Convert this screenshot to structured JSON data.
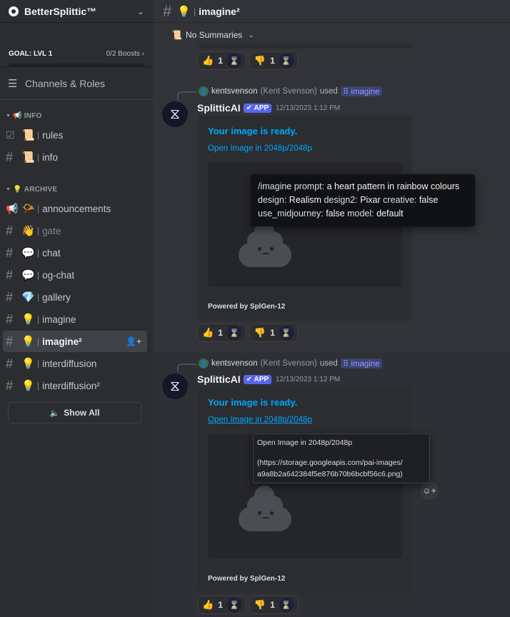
{
  "server": {
    "name": "BetterSplittic™",
    "chevron_icon": "chevron-down-icon"
  },
  "goal": {
    "label": "GOAL: LVL 1",
    "boosts": "0/2 Boosts",
    "progress": 0
  },
  "nav": {
    "channels_roles": "Channels & Roles"
  },
  "categories": [
    {
      "label": "INFO",
      "emoji": "📢"
    },
    {
      "label": "ARCHIVE",
      "emoji": "💡"
    }
  ],
  "channels": [
    {
      "emoji": "📜",
      "name": "rules",
      "icon": "rules-check-icon"
    },
    {
      "emoji": "📜",
      "name": "info",
      "icon": "hash-icon"
    },
    {
      "emoji": "📯",
      "name": "announcements",
      "icon": "megaphone-icon"
    },
    {
      "emoji": "👋",
      "name": "gate",
      "icon": "hash-icon"
    },
    {
      "emoji": "💬",
      "name": "chat",
      "icon": "hash-icon"
    },
    {
      "emoji": "💬",
      "name": "og-chat",
      "icon": "hash-icon"
    },
    {
      "emoji": "💎",
      "name": "gallery",
      "icon": "hash-icon"
    },
    {
      "emoji": "💡",
      "name": "imagine",
      "icon": "hash-icon"
    },
    {
      "emoji": "💡",
      "name": "imagine²",
      "icon": "hash-icon"
    },
    {
      "emoji": "💡",
      "name": "interdiffusion",
      "icon": "hash-icon"
    },
    {
      "emoji": "💡",
      "name": "interdiffusion²",
      "icon": "hash-icon"
    }
  ],
  "show_all": "Show All",
  "topbar": {
    "emoji": "💡",
    "title": "imagine²"
  },
  "summaries": {
    "label": "No Summaries"
  },
  "reactions": {
    "up_emoji": "👍",
    "down_emoji": "👎",
    "up_count": "1",
    "down_count": "1",
    "hourglass": "⌛"
  },
  "messages": [
    {
      "reply_user": "kentsvenson",
      "reply_real": "(Kent Svenson)",
      "reply_used": "used",
      "reply_cmd": "imagine",
      "author": "SplitticAI",
      "badge": "APP",
      "timestamp": "12/13/2023 1:12 PM",
      "embed_title": "Your image is ready.",
      "embed_link": "Open Image in 2048p/2048p",
      "footer": "Powered by SplGen-12"
    },
    {
      "reply_user": "kentsvenson",
      "reply_real": "(Kent Svenson)",
      "reply_used": "used",
      "reply_cmd": "imagine",
      "author": "SplitticAI",
      "badge": "APP",
      "timestamp": "12/13/2023 1:12 PM",
      "embed_title": "Your image is ready.",
      "embed_link": "Open Image in 2048p/2048p",
      "footer": "Powered by SplGen-12"
    }
  ],
  "tooltip_prompt": {
    "k1": "/imagine prompt:",
    "v1": "a heart pattern in rainbow colours",
    "k2": "design:",
    "v2": "Realism",
    "k3": "design2:",
    "v3": "Pixar",
    "k4": "creative:",
    "v4": "false",
    "k5": "use_midjourney:",
    "v5": "false",
    "k6": "model:",
    "v6": "default"
  },
  "tooltip_link": {
    "line1": "Open Image in 2048p/2048p",
    "line2": "(https://storage.googleapis.com/pai-images/",
    "line3": "a9a8b2a642384f5e876b70b6bcbf56c6.png)"
  }
}
